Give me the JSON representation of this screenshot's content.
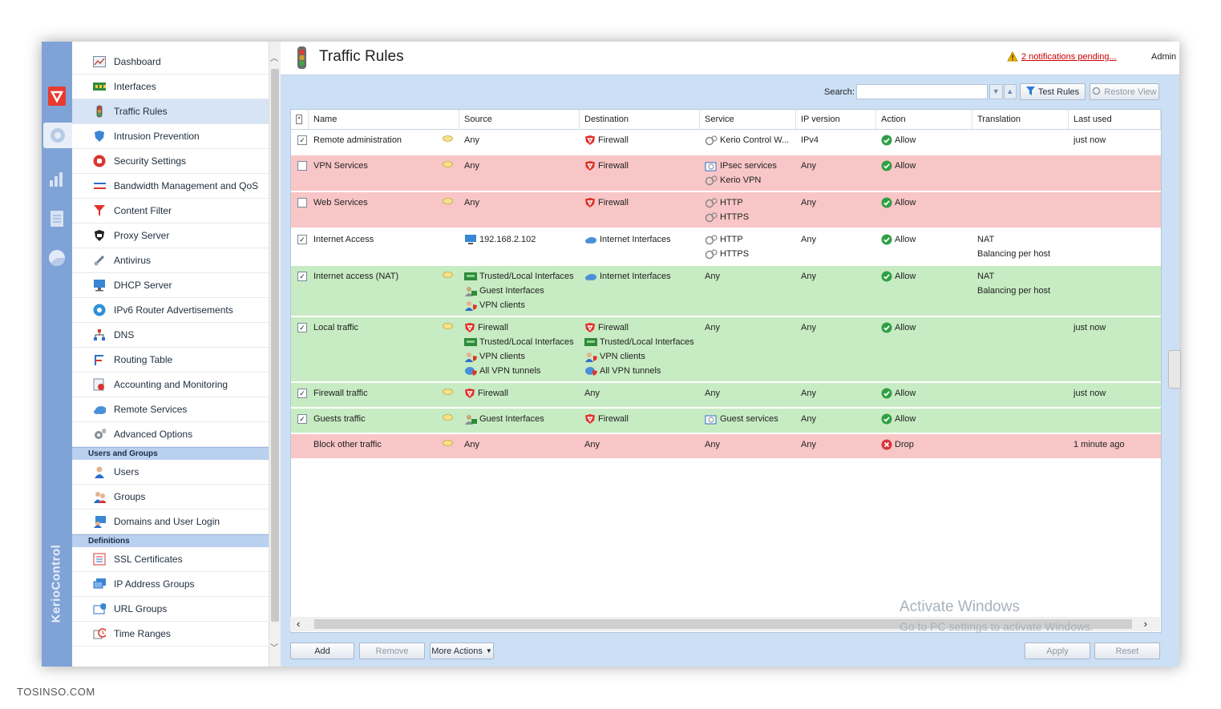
{
  "header": {
    "title": "Traffic Rules",
    "notifications": "2 notifications pending...",
    "user": "Admin"
  },
  "brand": "KerioControl",
  "sidebar": {
    "items": [
      {
        "label": "Dashboard",
        "icon": "dashboard-icon"
      },
      {
        "label": "Interfaces",
        "icon": "interfaces-icon"
      },
      {
        "label": "Traffic Rules",
        "icon": "traffic-light-icon"
      },
      {
        "label": "Intrusion Prevention",
        "icon": "shield-icon"
      },
      {
        "label": "Security Settings",
        "icon": "hand-stop-icon"
      },
      {
        "label": "Bandwidth Management and QoS",
        "icon": "bandwidth-icon"
      },
      {
        "label": "Content Filter",
        "icon": "filter-icon"
      },
      {
        "label": "Proxy Server",
        "icon": "proxy-icon"
      },
      {
        "label": "Antivirus",
        "icon": "antivirus-icon"
      },
      {
        "label": "DHCP Server",
        "icon": "dhcp-icon"
      },
      {
        "label": "IPv6 Router Advertisements",
        "icon": "ipv6-icon"
      },
      {
        "label": "DNS",
        "icon": "dns-icon"
      },
      {
        "label": "Routing Table",
        "icon": "routing-icon"
      },
      {
        "label": "Accounting and Monitoring",
        "icon": "monitoring-icon"
      },
      {
        "label": "Remote Services",
        "icon": "cloud-icon"
      },
      {
        "label": "Advanced Options",
        "icon": "gears-icon"
      }
    ],
    "group_users": "Users and Groups",
    "users_items": [
      {
        "label": "Users",
        "icon": "user-icon"
      },
      {
        "label": "Groups",
        "icon": "group-icon"
      },
      {
        "label": "Domains and User Login",
        "icon": "domain-icon"
      }
    ],
    "group_definitions": "Definitions",
    "definition_items": [
      {
        "label": "SSL Certificates",
        "icon": "certificate-icon"
      },
      {
        "label": "IP Address Groups",
        "icon": "ip-group-icon"
      },
      {
        "label": "URL Groups",
        "icon": "url-group-icon"
      },
      {
        "label": "Time Ranges",
        "icon": "clock-icon"
      }
    ]
  },
  "toolbar": {
    "search_label": "Search:",
    "test_rules": "Test Rules",
    "restore_view": "Restore View"
  },
  "columns": [
    "Name",
    "Source",
    "Destination",
    "Service",
    "IP version",
    "Action",
    "Translation",
    "Last used"
  ],
  "rows": [
    {
      "color": "white",
      "checked": true,
      "name": "Remote administration",
      "source": [
        "Any"
      ],
      "destination": [
        "Firewall"
      ],
      "service": [
        "Kerio Control W..."
      ],
      "ipver": "IPv4",
      "action": "Allow",
      "translation": [],
      "last": "just now"
    },
    {
      "color": "red",
      "checked": false,
      "name": "VPN Services",
      "source": [
        "Any"
      ],
      "destination": [
        "Firewall"
      ],
      "service": [
        "IPsec services",
        "Kerio VPN"
      ],
      "ipver": "Any",
      "action": "Allow",
      "translation": [],
      "last": ""
    },
    {
      "color": "red",
      "checked": false,
      "name": "Web Services",
      "source": [
        "Any"
      ],
      "destination": [
        "Firewall"
      ],
      "service": [
        "HTTP",
        "HTTPS"
      ],
      "ipver": "Any",
      "action": "Allow",
      "translation": [],
      "last": ""
    },
    {
      "color": "white",
      "checked": true,
      "name": "Internet Access",
      "source": [
        "192.168.2.102"
      ],
      "destination": [
        "Internet Interfaces"
      ],
      "service": [
        "HTTP",
        "HTTPS"
      ],
      "ipver": "Any",
      "action": "Allow",
      "translation": [
        "NAT",
        "Balancing per host"
      ],
      "last": ""
    },
    {
      "color": "green",
      "checked": true,
      "name": "Internet access (NAT)",
      "source": [
        "Trusted/Local Interfaces",
        "Guest Interfaces",
        "VPN clients"
      ],
      "destination": [
        "Internet Interfaces"
      ],
      "service": [
        "Any"
      ],
      "ipver": "Any",
      "action": "Allow",
      "translation": [
        "NAT",
        "Balancing per host"
      ],
      "last": ""
    },
    {
      "color": "green",
      "checked": true,
      "name": "Local traffic",
      "source": [
        "Firewall",
        "Trusted/Local Interfaces",
        "VPN clients",
        "All VPN tunnels"
      ],
      "destination": [
        "Firewall",
        "Trusted/Local Interfaces",
        "VPN clients",
        "All VPN tunnels"
      ],
      "service": [
        "Any"
      ],
      "ipver": "Any",
      "action": "Allow",
      "translation": [],
      "last": "just now"
    },
    {
      "color": "green",
      "checked": true,
      "name": "Firewall traffic",
      "source": [
        "Firewall"
      ],
      "destination": [
        "Any"
      ],
      "service": [
        "Any"
      ],
      "ipver": "Any",
      "action": "Allow",
      "translation": [],
      "last": "just now"
    },
    {
      "color": "green",
      "checked": true,
      "name": "Guests traffic",
      "source": [
        "Guest Interfaces"
      ],
      "destination": [
        "Firewall"
      ],
      "service": [
        "Guest services"
      ],
      "ipver": "Any",
      "action": "Allow",
      "translation": [],
      "last": ""
    },
    {
      "color": "red",
      "checked": null,
      "name": "Block other traffic",
      "source": [
        "Any"
      ],
      "destination": [
        "Any"
      ],
      "service": [
        "Any"
      ],
      "ipver": "Any",
      "action": "Drop",
      "translation": [],
      "last": "1 minute ago"
    }
  ],
  "bottom_buttons": {
    "add": "Add",
    "remove": "Remove",
    "more_actions": "More Actions",
    "apply": "Apply",
    "reset": "Reset"
  },
  "watermark": {
    "line1": "Activate Windows",
    "line2": "Go to PC settings to activate Windows."
  },
  "site": "TOSINSO.COM",
  "colors": {
    "rail": "#7fa3d6",
    "main_bg": "#cbdff5",
    "row_red": "#f8c6c6",
    "row_green": "#c7ebc3",
    "allow": "#2ea043",
    "drop": "#d9363e"
  }
}
